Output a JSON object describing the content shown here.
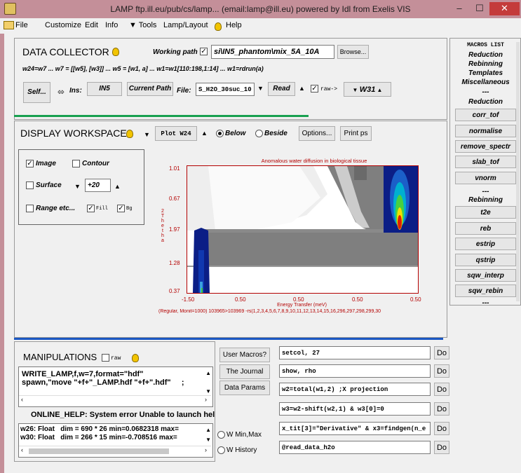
{
  "window": {
    "title": "LAMP ftp.ill.eu/pub/cs/lamp... (email:lamp@ill.eu)    powered by Idl from Exelis VIS",
    "min": "–",
    "max": "☐",
    "close": "✕"
  },
  "menubar": {
    "file": "File",
    "customize": "Customize",
    "edit": "Edit",
    "info": "Info",
    "tools": "▼ Tools",
    "layout": "Lamp/Layout",
    "help": "Help"
  },
  "data_collector": {
    "title": "DATA COLLECTOR",
    "working_path_label": "Working path",
    "path_value": "si\\IN5_phantom\\mix_5A_10A",
    "browse": "Browse...",
    "formula": "w24=w7 ... w7 = [[w5], [w3]] ... w5 = [w1, a] ... w1=w1[110:198,1:14] ... w1=rdrun(a)",
    "self": "Self...",
    "ins_label": "Ins:",
    "ins_value": "IN5",
    "current_path": "Current Path",
    "file_label": "File:",
    "file_value": "S_H2O_30suc_10",
    "read": "Read",
    "raw_label": "raw->",
    "target": "W31"
  },
  "display": {
    "title": "DISPLAY WORKSPACE",
    "plot": "Plot W24",
    "below": "Below",
    "beside": "Beside",
    "options": "Options...",
    "print": "Print ps",
    "image": "Image",
    "contour": "Contour",
    "surface": "Surface",
    "angle": "+20",
    "range": "Range etc...",
    "fill": "Fill",
    "bg": "Bg"
  },
  "plot": {
    "title": "Anomalous water diffusion in biological tissue",
    "y_axis_letters": [
      "2",
      "T",
      "h",
      "e",
      "t",
      "h",
      "a"
    ],
    "y_ticks": [
      "1.01",
      "0.67",
      "1.97",
      "1.28",
      "0.37"
    ],
    "x_ticks": [
      "-1.50",
      "0.50",
      "0.50",
      "0.50",
      "0.50"
    ],
    "xlabel": "Energy Transfer (meV)",
    "footer": "(Regular, Monit=1000) 103965>103969 -rs(1,2,3,4,5,6,7,8,9,10,11,12,13,14,15,16,296,297,298,299,30"
  },
  "macros": {
    "title": "MACROS LIST",
    "items_top": [
      "Reduction",
      "Rebinning",
      "Templates",
      "Miscellaneous",
      "---",
      "Reduction"
    ],
    "buttons_a": [
      "corr_tof",
      "normalise",
      "remove_spectr",
      "slab_tof",
      "vnorm"
    ],
    "mid": [
      "---",
      "Rebinning"
    ],
    "buttons_b": [
      "t2e",
      "reb",
      "estrip",
      "qstrip",
      "sqw_interp",
      "sqw_rebin"
    ],
    "end": "---"
  },
  "manipulations": {
    "title": "MANIPULATIONS",
    "raw_label": "raw",
    "code_lines": [
      "WRITE_LAMP,f,w=7,format=\"hdf\"",
      "spawn,\"move \"+f+\"_LAMP.hdf \"+f+\".hdf\"     ;"
    ],
    "user_macros": "User Macros?",
    "journal": "The Journal",
    "data_params": "Data Params",
    "help_message": "ONLINE_HELP: System error Unable to launch help viewer",
    "vars": [
      "w26: Float   dim = 690 * 26 min=0.0682318 max=",
      "w30: Float   dim = 266 * 15 min=-0.708516 max="
    ],
    "wminmax": "W Min,Max",
    "whistory": "W History",
    "commands": [
      "setcol, 27",
      "show, rho",
      "w2=total(w1,2) ;X projection",
      "w3=w2-shift(w2,1) &  w3[0]=0",
      "x_tit[3]=\"Derivative\" & x3=findgen(n_e",
      "@read_data_h2o"
    ],
    "do": "Do"
  }
}
